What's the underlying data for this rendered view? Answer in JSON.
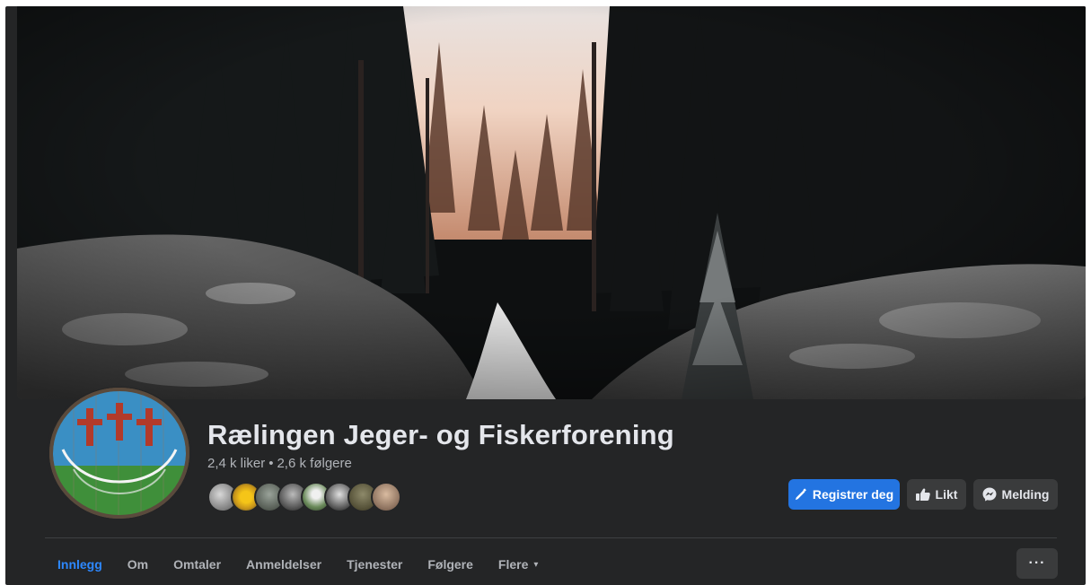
{
  "page": {
    "name": "Rælingen Jeger- og Fiskerforening",
    "likes": "2,4 k liker",
    "separator": "•",
    "followers": "2,6 k følgere"
  },
  "actions": {
    "register": "Registrer deg",
    "liked": "Likt",
    "message": "Melding"
  },
  "tabs": [
    {
      "label": "Innlegg",
      "active": true
    },
    {
      "label": "Om",
      "active": false
    },
    {
      "label": "Omtaler",
      "active": false
    },
    {
      "label": "Anmeldelser",
      "active": false
    },
    {
      "label": "Tjenester",
      "active": false
    },
    {
      "label": "Følgere",
      "active": false
    },
    {
      "label": "Flere",
      "active": false
    }
  ],
  "tab_more_caret": "▾",
  "more_options": "···",
  "colors": {
    "background": "#242526",
    "primary": "#2374e1",
    "active_tab": "#2d88ff",
    "secondary_button": "#3a3b3c"
  },
  "icons": {
    "register": "pencil-icon",
    "liked": "thumbs-up-icon",
    "message": "messenger-icon"
  }
}
